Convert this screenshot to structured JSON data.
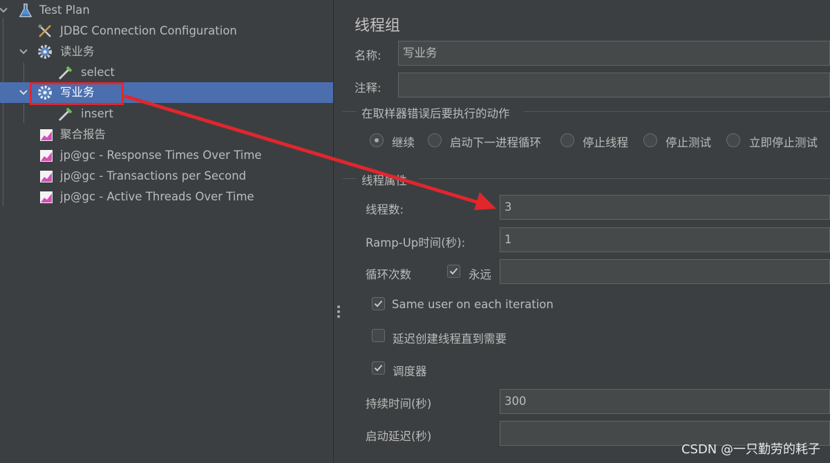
{
  "tree": {
    "items": [
      {
        "label": "Test Plan",
        "icon": "flask-icon"
      },
      {
        "label": "JDBC Connection Configuration",
        "icon": "wrench-icon"
      },
      {
        "label": "读业务",
        "icon": "gear-icon"
      },
      {
        "label": "select",
        "icon": "sampler-icon"
      },
      {
        "label": "写业务",
        "icon": "gear-icon"
      },
      {
        "label": "insert",
        "icon": "sampler-icon"
      },
      {
        "label": "聚合报告",
        "icon": "chart-icon"
      },
      {
        "label": "jp@gc - Response Times Over Time",
        "icon": "chart-icon"
      },
      {
        "label": "jp@gc - Transactions per Second",
        "icon": "chart-icon"
      },
      {
        "label": "jp@gc - Active Threads Over Time",
        "icon": "chart-icon"
      }
    ],
    "selected": "写业务"
  },
  "form": {
    "title": "线程组",
    "name_label": "名称:",
    "name_value": "写业务",
    "comment_label": "注释:",
    "comment_value": "",
    "error_section_title": "在取样器错误后要执行的动作",
    "error_actions": [
      "继续",
      "启动下一进程循环",
      "停止线程",
      "停止测试",
      "立即停止测试"
    ],
    "error_action_selected": "继续",
    "props_section_title": "线程属性",
    "threads_label": "线程数:",
    "threads_value": "3",
    "rampup_label": "Ramp-Up时间(秒):",
    "rampup_value": "1",
    "loop_label": "循环次数",
    "forever_label": "永远",
    "forever_checked": true,
    "loop_value": "",
    "same_user_label": "Same user on each iteration",
    "same_user_checked": true,
    "delay_label": "延迟创建线程直到需要",
    "delay_checked": false,
    "scheduler_label": "调度器",
    "scheduler_checked": true,
    "duration_label": "持续时间(秒)",
    "duration_value": "300",
    "startup_delay_label": "启动延迟(秒)",
    "startup_delay_value": ""
  },
  "watermark": "CSDN @一只勤劳的耗子",
  "colors": {
    "panel_bg": "#3c3f41",
    "selection": "#4b6eaf",
    "annotation_red": "#e1262d",
    "field_bg": "#45494a"
  }
}
